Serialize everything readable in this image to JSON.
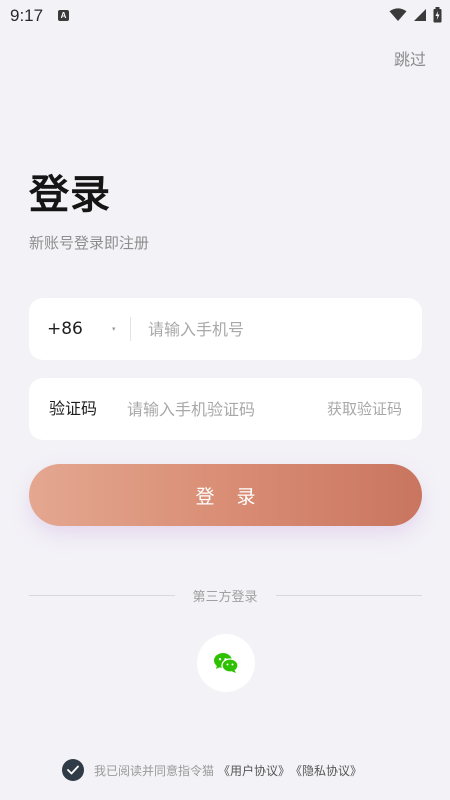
{
  "status_bar": {
    "time": "9:17",
    "app_icon_glyph": "A",
    "icons": [
      "wifi-icon",
      "signal-icon",
      "battery-icon"
    ]
  },
  "header": {
    "skip_label": "跳过"
  },
  "main": {
    "title": "登录",
    "subtitle": "新账号登录即注册"
  },
  "phone_field": {
    "country_code": "+86",
    "caret": "▾",
    "value": "",
    "placeholder": "请输入手机号"
  },
  "code_field": {
    "label": "验证码",
    "value": "",
    "placeholder": "请输入手机验证码",
    "get_code_label": "获取验证码"
  },
  "login_button": {
    "label": "登 录"
  },
  "third_party": {
    "label": "第三方登录",
    "wechat_icon": "wechat-icon"
  },
  "agreement": {
    "checked": true,
    "text": "我已阅读并同意指令猫",
    "user_agreement": "《用户协议》",
    "privacy_policy": "《隐私协议》"
  },
  "colors": {
    "background": "#f3f2f7",
    "button_start": "#e4a790",
    "button_end": "#c97560",
    "wechat_green": "#2dc100",
    "checkbox": "#2f3b46"
  }
}
